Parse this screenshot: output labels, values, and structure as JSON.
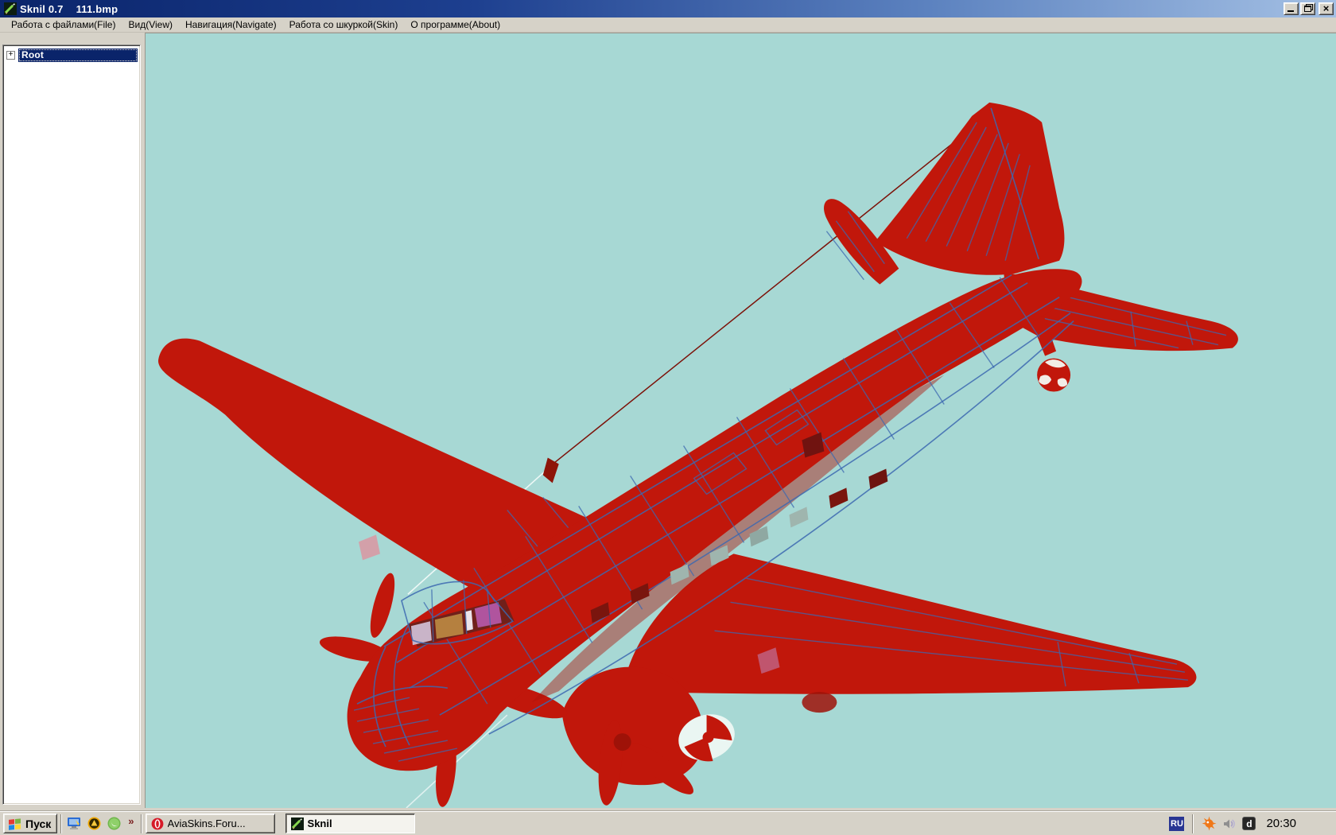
{
  "colors": {
    "background": "#a7d8d4",
    "plane_red": "#c1170b",
    "plane_red_dark": "#9e1208",
    "wireframe_blue": "#3c68b0",
    "antenna_red": "#7c1108",
    "chrome": "#d6d2c8",
    "title_start": "#0a246a",
    "title_end": "#a4c0e4",
    "sel": "#0a246a",
    "active_task_bg": "#f4f3ee"
  },
  "window": {
    "app_name": "Sknil 0.7",
    "document_name": "111.bmp",
    "close_glyph": "×"
  },
  "menu_bar": {
    "items": [
      {
        "label": "Работа с файлами(File)"
      },
      {
        "label": "Вид(View)"
      },
      {
        "label": "Навигация(Navigate)"
      },
      {
        "label": "Работа со шкуркой(Skin)"
      },
      {
        "label": "О программе(About)"
      }
    ]
  },
  "sidebar": {
    "tree": {
      "expander_glyph": "+",
      "root_label": "Root"
    }
  },
  "viewer": {
    "subject": "red-aircraft-3d-model"
  },
  "taskbar": {
    "start": {
      "label": "Пуск"
    },
    "quick_launch": {
      "icons": [
        "show-desktop",
        "yellow-app",
        "green-app"
      ],
      "overflow_glyph": "»"
    },
    "tasks": [
      {
        "icon": "opera",
        "label": "AviaSkins.Foru...",
        "active": false
      },
      {
        "icon": "sknil",
        "label": "Sknil",
        "active": true
      }
    ],
    "tray": {
      "language_indicator": "RU",
      "icons": [
        "avast",
        "volume",
        "download-master"
      ],
      "download_master_glyph": "d",
      "clock": "20:30"
    }
  }
}
